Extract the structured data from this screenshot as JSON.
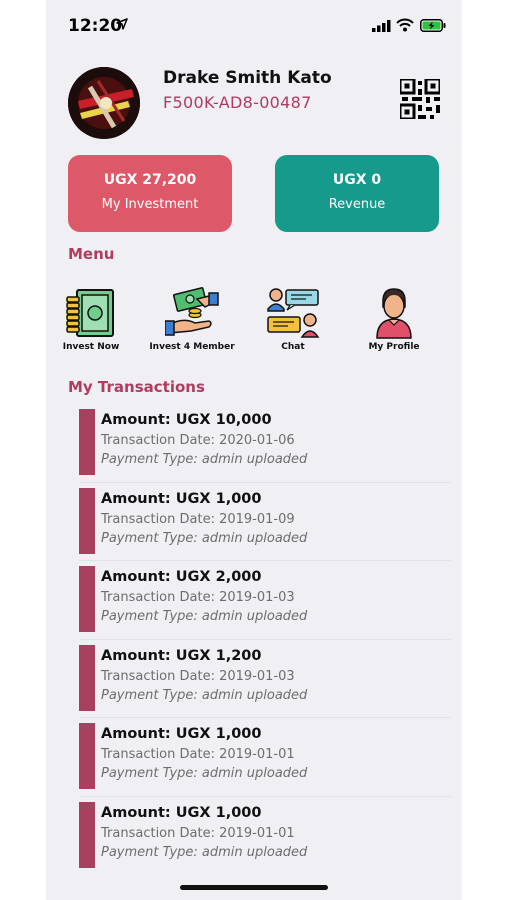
{
  "status": {
    "time": "12:20"
  },
  "profile": {
    "name": "Drake Smith Kato",
    "code": "F500K-AD8-00487"
  },
  "cards": {
    "investment": {
      "amount": "UGX 27,200",
      "label": "My Investment"
    },
    "revenue": {
      "amount": "UGX 0",
      "label": "Revenue"
    }
  },
  "menu": {
    "title": "Menu",
    "items": [
      {
        "label": "Invest Now",
        "icon": "money-stack-icon"
      },
      {
        "label": "Invest 4 Member",
        "icon": "handshake-money-icon"
      },
      {
        "label": "Chat",
        "icon": "chat-icon"
      },
      {
        "label": "My Profile",
        "icon": "profile-icon"
      }
    ]
  },
  "transactions": {
    "title": "My Transactions",
    "items": [
      {
        "amount": "Amount: UGX 10,000",
        "date": "Transaction Date: 2020-01-06",
        "type": "Payment Type: admin uploaded"
      },
      {
        "amount": "Amount: UGX 1,000",
        "date": "Transaction Date: 2019-01-09",
        "type": "Payment Type: admin uploaded"
      },
      {
        "amount": "Amount: UGX 2,000",
        "date": "Transaction Date: 2019-01-03",
        "type": "Payment Type: admin uploaded"
      },
      {
        "amount": "Amount: UGX 1,200",
        "date": "Transaction Date: 2019-01-03",
        "type": "Payment Type: admin uploaded"
      },
      {
        "amount": "Amount: UGX 1,000",
        "date": "Transaction Date: 2019-01-01",
        "type": "Payment Type: admin uploaded"
      },
      {
        "amount": "Amount: UGX 1,000",
        "date": "Transaction Date: 2019-01-01",
        "type": "Payment Type: admin uploaded"
      }
    ]
  },
  "colors": {
    "investment_card": "#dd5868",
    "revenue_card": "#169a8c",
    "accent": "#b03d5f",
    "transaction_bar": "#a8405f"
  }
}
